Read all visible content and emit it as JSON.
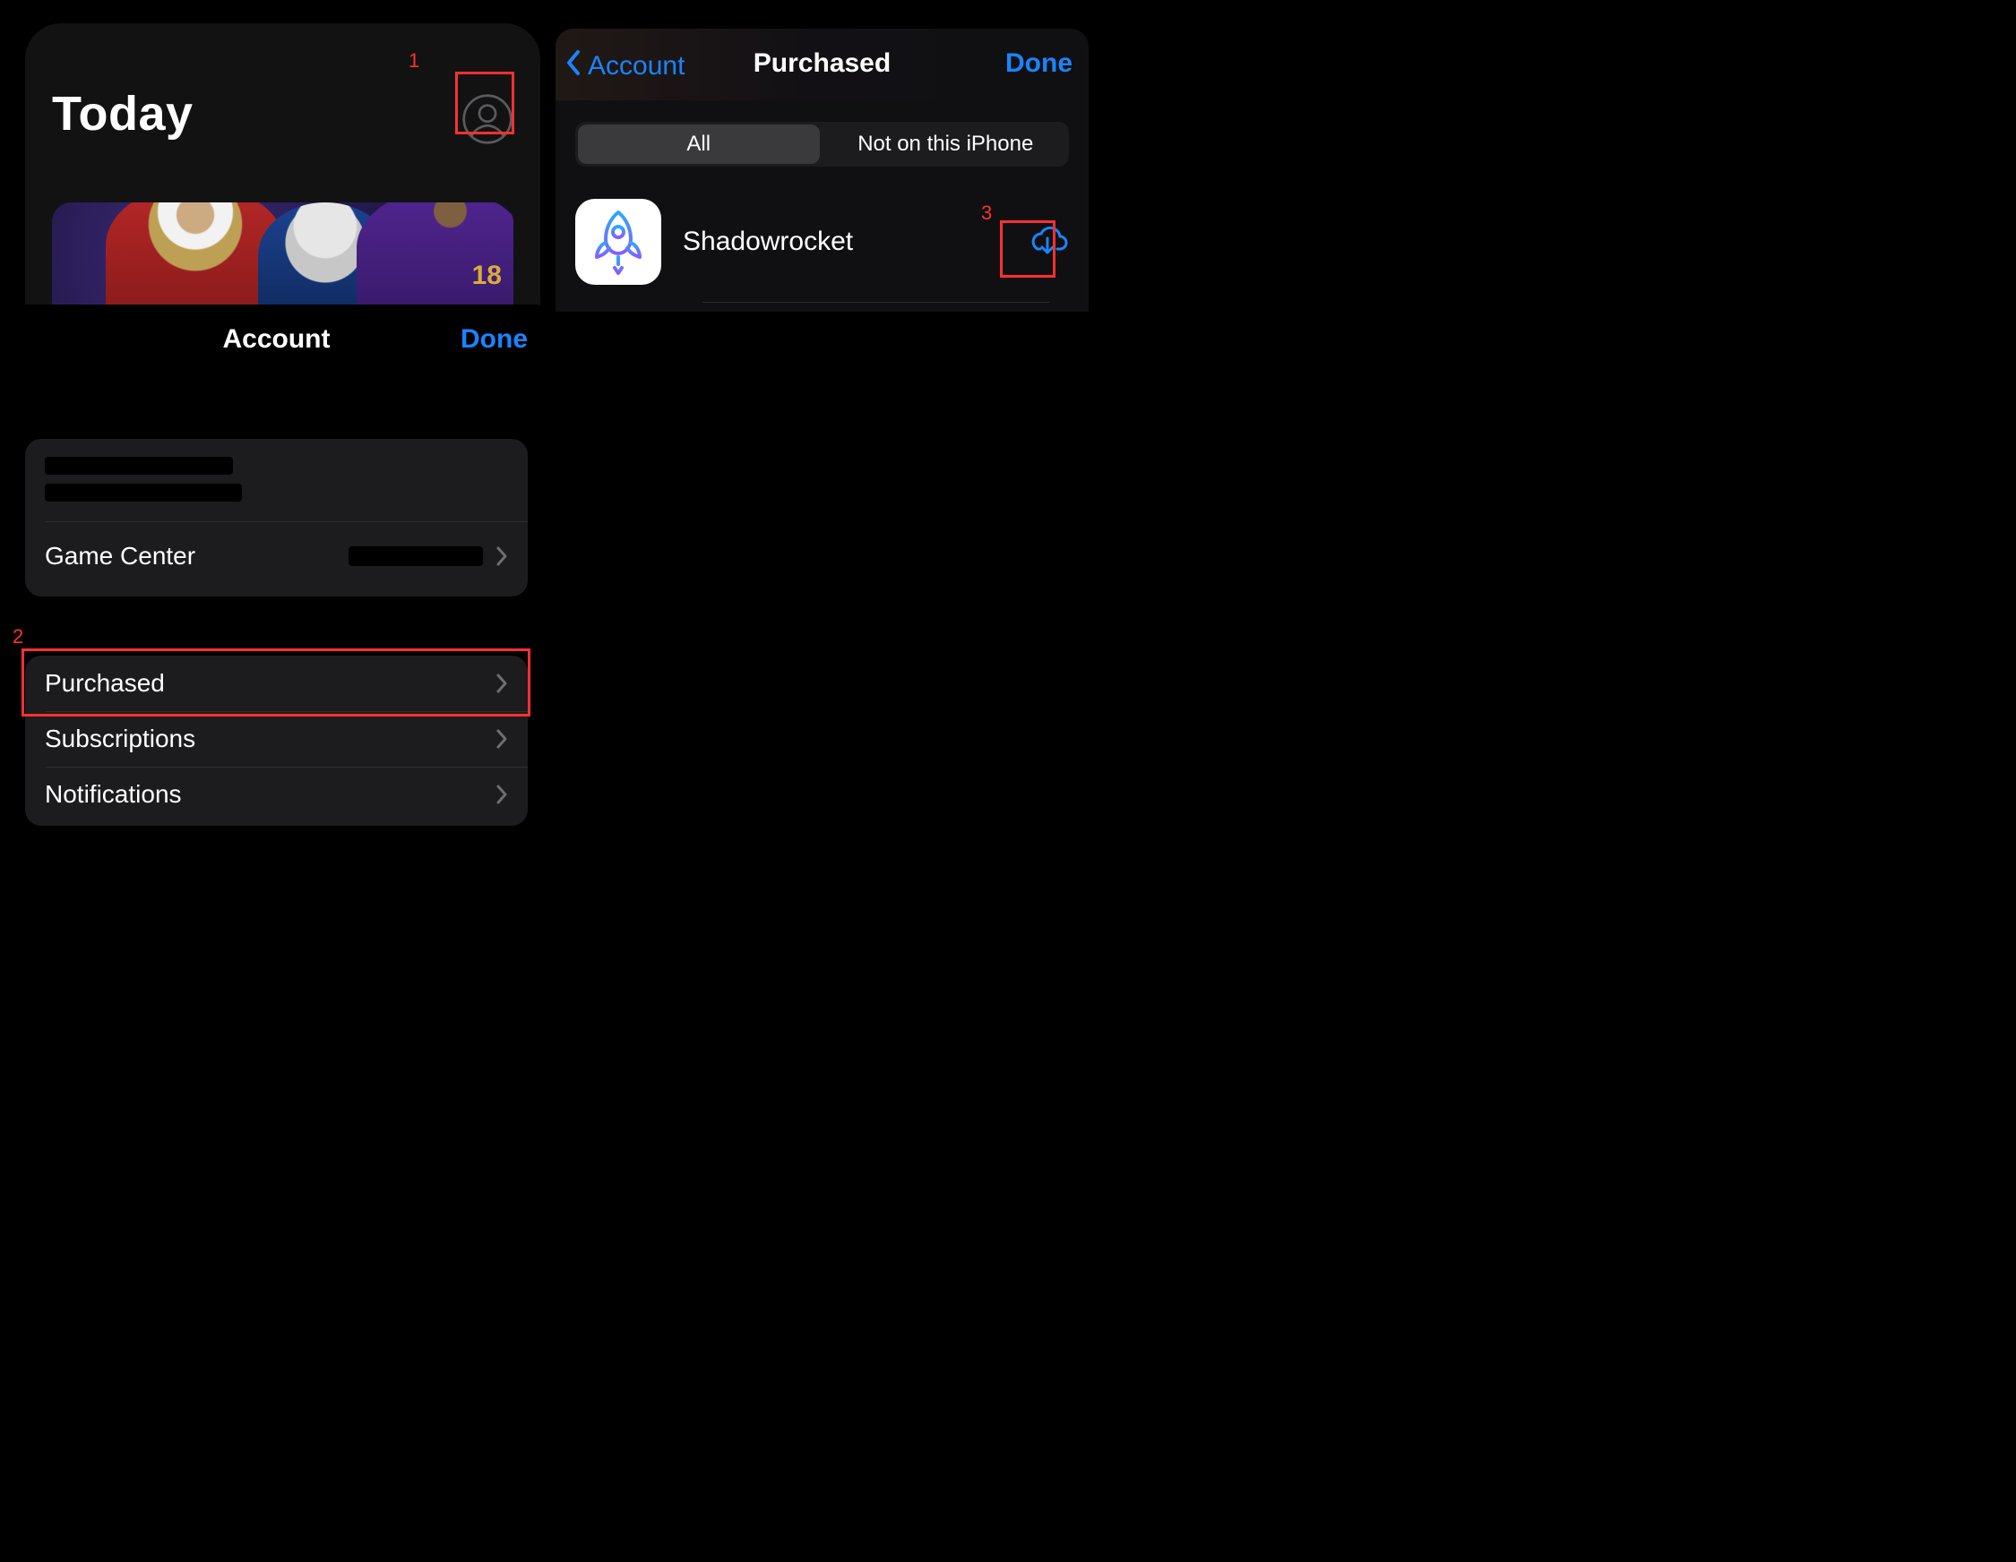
{
  "colors": {
    "accent": "#1a84ff",
    "annot": "#ff3030"
  },
  "today": {
    "title": "Today",
    "hero_jersey_number": "18"
  },
  "annotations": {
    "n1": "1",
    "n2": "2",
    "n3": "3"
  },
  "account": {
    "title": "Account",
    "done": "Done",
    "game_center_label": "Game Center",
    "rows": [
      {
        "label": "Purchased"
      },
      {
        "label": "Subscriptions"
      },
      {
        "label": "Notifications"
      }
    ]
  },
  "purchased": {
    "back_label": "Account",
    "title": "Purchased",
    "done": "Done",
    "segments": {
      "all": "All",
      "not_on_device": "Not on this iPhone"
    },
    "apps": [
      {
        "name": "Shadowrocket"
      }
    ]
  }
}
